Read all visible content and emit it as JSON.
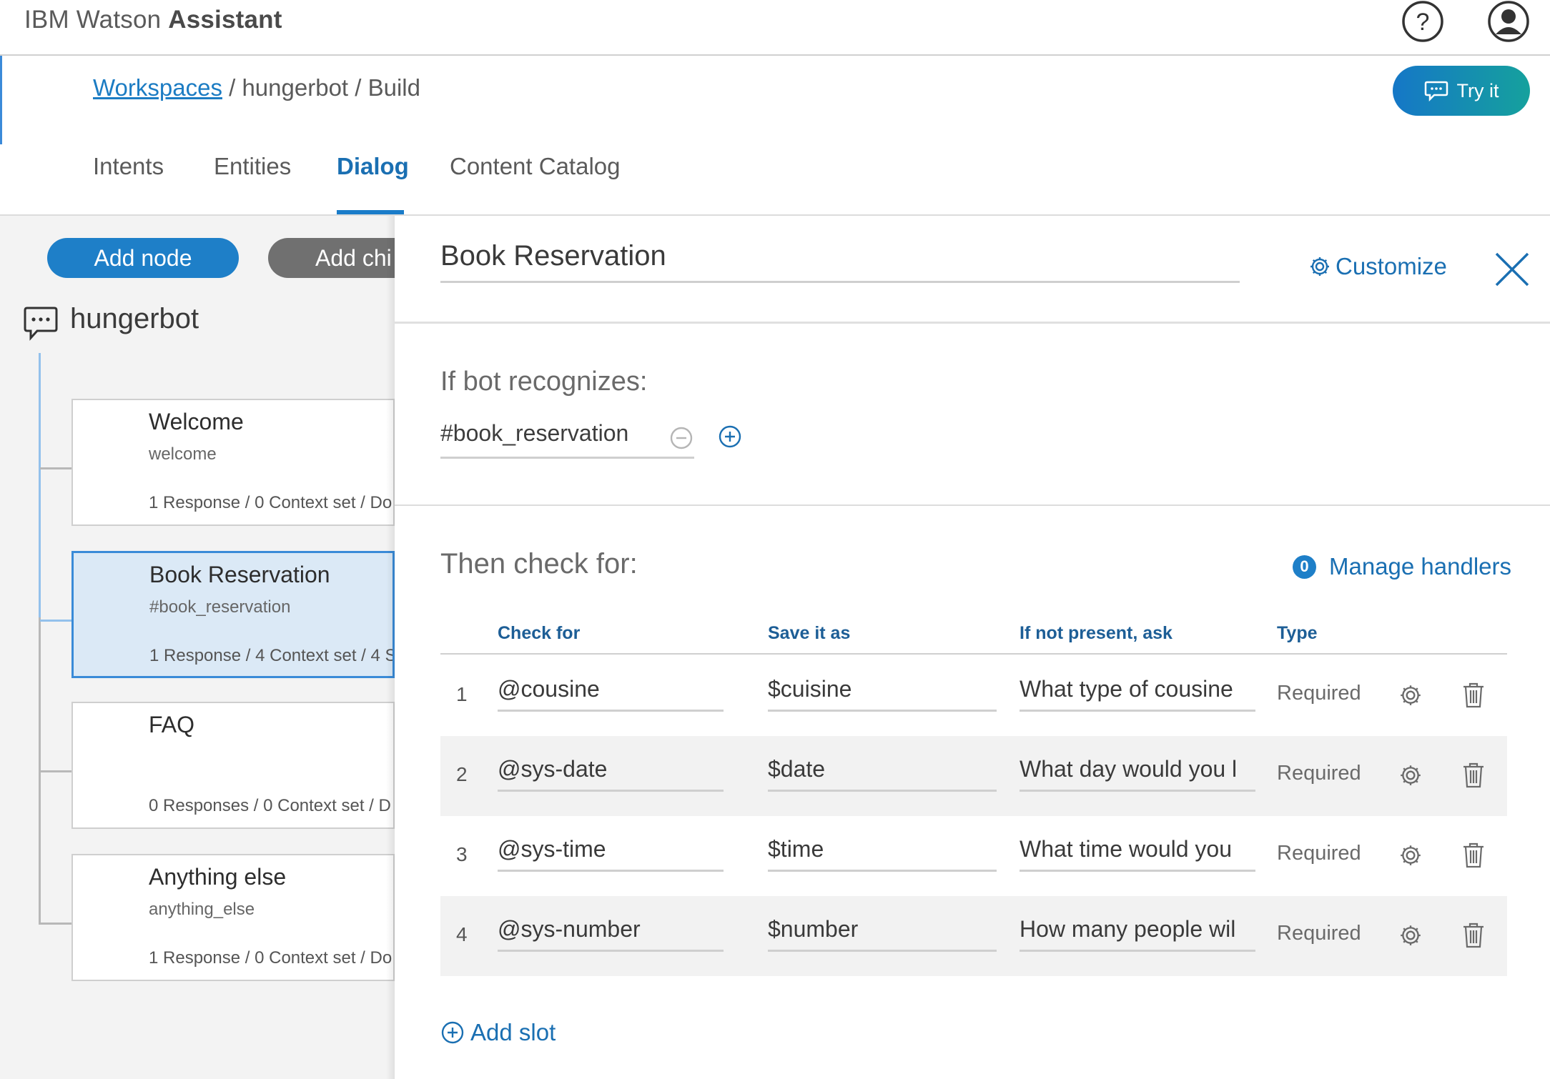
{
  "app": {
    "brand_light": "IBM Watson",
    "brand_bold": "Assistant"
  },
  "header": {
    "breadcrumb_link": "Workspaces",
    "breadcrumb_rest": " / hungerbot / Build",
    "try_label": "Try it",
    "tabs": [
      "Intents",
      "Entities",
      "Dialog",
      "Content Catalog"
    ],
    "active_tab": "Dialog"
  },
  "tree": {
    "add_node_label": "Add node",
    "add_child_label": "Add chi",
    "root_label": "hungerbot",
    "nodes": [
      {
        "title": "Welcome",
        "condition": "welcome",
        "meta": "1 Response / 0 Context set / Do"
      },
      {
        "title": "Book Reservation",
        "condition": "#book_reservation",
        "meta": "1 Response / 4 Context set / 4 S"
      },
      {
        "title": "FAQ",
        "condition": "",
        "meta": "0 Responses / 0 Context set / D"
      },
      {
        "title": "Anything else",
        "condition": "anything_else",
        "meta": "1 Response / 0 Context set / Do"
      }
    ]
  },
  "panel": {
    "node_name": "Book Reservation",
    "customize_label": "Customize",
    "recognizes_label": "If bot recognizes:",
    "condition": "#book_reservation",
    "check_label": "Then check for:",
    "handlers_count": "0",
    "handlers_label": "Manage handlers",
    "columns": {
      "check": "Check for",
      "save": "Save it as",
      "ask": "If not present, ask",
      "type": "Type"
    },
    "slots": [
      {
        "num": "1",
        "check": "@cousine",
        "save": "$cuisine",
        "ask": "What type of cousine",
        "type": "Required"
      },
      {
        "num": "2",
        "check": "@sys-date",
        "save": "$date",
        "ask": "What day would you l",
        "type": "Required"
      },
      {
        "num": "3",
        "check": "@sys-time",
        "save": "$time",
        "ask": "What time would you",
        "type": "Required"
      },
      {
        "num": "4",
        "check": "@sys-number",
        "save": "$number",
        "ask": "How many people wil",
        "type": "Required"
      }
    ],
    "add_slot_label": "Add slot"
  },
  "colors": {
    "accent": "#1e7fc8",
    "link": "#1a6fb2",
    "try_gradient_start": "#1577c7",
    "try_gradient_end": "#15a19d",
    "selected_node": "#dbe9f6"
  },
  "icons": [
    "help-icon",
    "user-icon",
    "chat-icon",
    "gear-icon",
    "close-icon",
    "minus-circle-icon",
    "plus-circle-icon",
    "trash-icon"
  ]
}
